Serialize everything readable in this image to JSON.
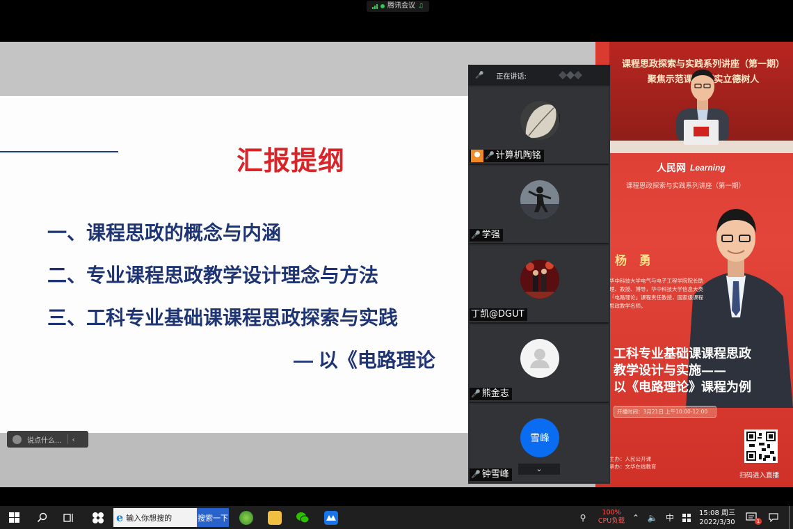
{
  "meeting": {
    "app_name": "腾讯会议"
  },
  "slide": {
    "title": "汇报提纲",
    "outline": [
      "一、课程思政的概念与内涵",
      "二、专业课程思政教学设计理念与方法",
      "三、工科专业基础课课程思政探索与实践"
    ],
    "subnote": "— 以《电路理论"
  },
  "chat": {
    "placeholder": "说点什么..."
  },
  "panel": {
    "header": "正在讲话:",
    "participants": [
      {
        "name": "计算机陶铭",
        "host": true
      },
      {
        "name": "学强",
        "host": false
      },
      {
        "name": "丁凯@DGUT",
        "host": false
      },
      {
        "name": "熊金志",
        "host": false
      },
      {
        "name": "钟雪峰",
        "host": false,
        "avatar_text": "雪峰"
      }
    ]
  },
  "poster": {
    "video_banner_1": "课程思政探索与实践系列讲座（第一期）",
    "video_banner_2": "聚焦示范课程 落实立德树人",
    "logo_1": "人民网",
    "logo_2": "Learning",
    "series": "课程思政探索与实践系列讲座（第一期）",
    "speaker": "杨 勇",
    "bio": "华中科技大学电气与电子工程学院院长助理、教授、博导，华中科技大学信息大类「电路理论」课程责任教授，国家级课程思政教学名师。",
    "talk_title_1": "工科专业基础课课程思政",
    "talk_title_2": "教学设计与实施——",
    "talk_title_3": "以《电路理论》课程为例",
    "time": "开播时间：3月21日 上午10:00-12:00",
    "organizer_1": "主办：人民公开课",
    "organizer_2": "承办：文华在线教育",
    "qr_label": "扫码进入直播"
  },
  "taskbar": {
    "search_placeholder": "输入你想搜的",
    "search_button": "搜索一下",
    "cpu_percent": "100%",
    "cpu_label": "CPU负载",
    "ime": "中",
    "time": "15:08 周三",
    "date": "2022/3/30",
    "notification_count": "1"
  },
  "colors": {
    "slide_title": "#d6262a",
    "slide_text": "#1f3573",
    "poster_red": "#d93a30",
    "accent_blue": "#0a6cf0",
    "cpu_warning": "#ff5a5a"
  }
}
